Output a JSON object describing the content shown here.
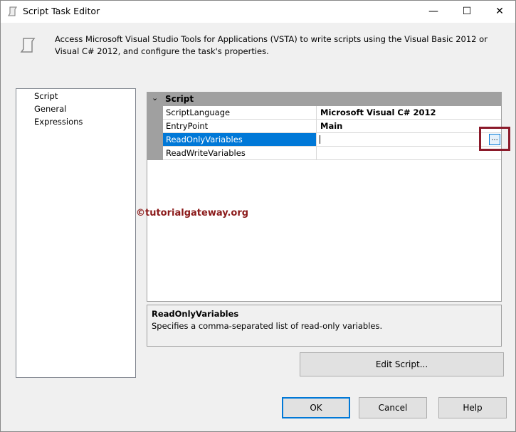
{
  "window": {
    "title": "Script Task Editor",
    "minimize": "—",
    "maximize": "☐",
    "close": "✕"
  },
  "description": "Access Microsoft Visual Studio Tools for Applications (VSTA) to write scripts using the Visual Basic 2012 or Visual C# 2012, and configure the task's properties.",
  "nav": [
    "Script",
    "General",
    "Expressions"
  ],
  "grid": {
    "category": "Script",
    "rows": [
      {
        "name": "ScriptLanguage",
        "value": "Microsoft Visual C# 2012"
      },
      {
        "name": "EntryPoint",
        "value": "Main"
      },
      {
        "name": "ReadOnlyVariables",
        "value": ""
      },
      {
        "name": "ReadWriteVariables",
        "value": ""
      }
    ],
    "ellipsis": "..."
  },
  "watermark": "©tutorialgateway.org",
  "help_box": {
    "title": "ReadOnlyVariables",
    "text": "Specifies a comma-separated list of read-only variables."
  },
  "buttons": {
    "edit_script": "Edit Script...",
    "ok": "OK",
    "cancel": "Cancel",
    "help": "Help"
  },
  "colors": {
    "selection": "#0078d7",
    "highlight": "#8b1a2a",
    "watermark": "#8b1a1a"
  }
}
